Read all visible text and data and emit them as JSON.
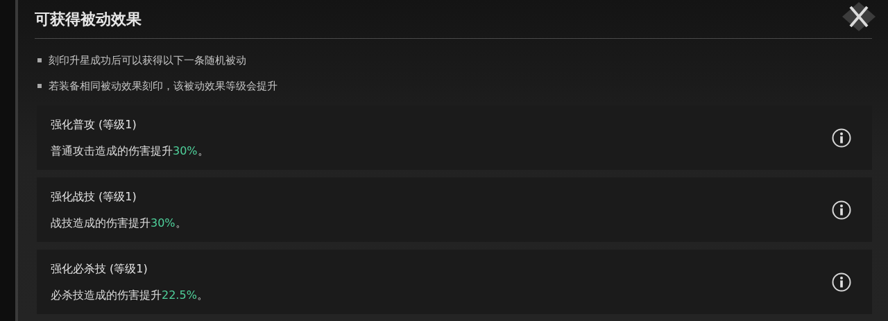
{
  "title": "可获得被动效果",
  "notes": [
    "刻印升星成功后可以获得以下一条随机被动",
    "若装备相同被动效果刻印，该被动效果等级会提升"
  ],
  "effects": [
    {
      "name": "强化普攻 (等级1)",
      "desc_before": "普通攻击造成的伤害提升",
      "desc_value": "30%",
      "desc_after": "。"
    },
    {
      "name": "强化战技 (等级1)",
      "desc_before": "战技造成的伤害提升",
      "desc_value": "30%",
      "desc_after": "。"
    },
    {
      "name": "强化必杀技 (等级1)",
      "desc_before": "必杀技造成的伤害提升",
      "desc_value": "22.5%",
      "desc_after": "。"
    }
  ]
}
